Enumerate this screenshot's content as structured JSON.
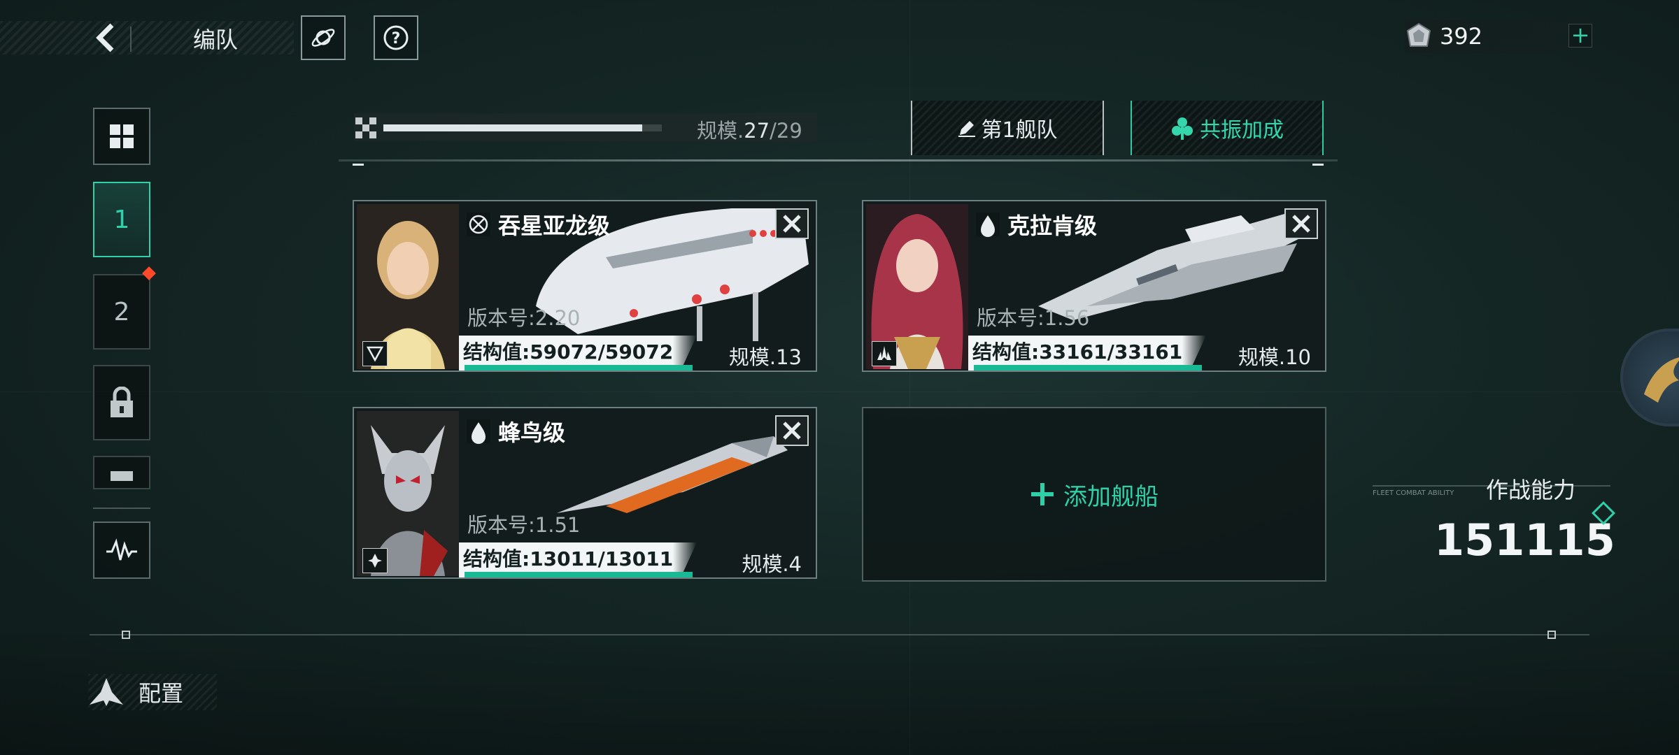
{
  "header": {
    "title": "编队",
    "currency_value": "392",
    "currency_plus": "+"
  },
  "sidebar": {
    "team_tabs": [
      "1",
      "2"
    ]
  },
  "fleet": {
    "scale_label": "规模.",
    "scale_current": "27",
    "scale_max": "/29",
    "scale_fill": 0.93,
    "fleet_button": "第1舰队",
    "resonance_button": "共振加成"
  },
  "ships": [
    {
      "name": "吞星亚龙级",
      "version": "版本号:2.20",
      "hp": "结构值:59072/59072",
      "scale": "规模.13",
      "hp_ratio": 1.0
    },
    {
      "name": "克拉肯级",
      "version": "版本号:1.56",
      "hp": "结构值:33161/33161",
      "scale": "规模.10",
      "hp_ratio": 1.0
    },
    {
      "name": "蜂鸟级",
      "version": "版本号:1.51",
      "hp": "结构值:13011/13011",
      "scale": "规模.4",
      "hp_ratio": 1.0
    }
  ],
  "add_ship": "添加舰船",
  "power": {
    "label": "作战能力",
    "value": "151115",
    "deco": "FLEET COMBAT ABILITY"
  },
  "bottom": {
    "config_label": "配置"
  },
  "colors": {
    "accent": "#2fd0aa",
    "hp_bar": "#1ab995",
    "alert": "#ff4a2a"
  }
}
